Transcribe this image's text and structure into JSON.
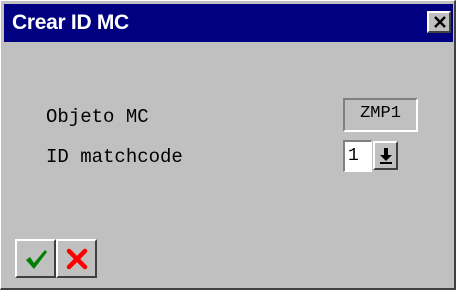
{
  "window": {
    "title": "Crear ID MC",
    "close_icon": "close-icon"
  },
  "form": {
    "objeto_label": "Objeto MC",
    "objeto_value": "ZMP1",
    "matchcode_label": "ID matchcode",
    "matchcode_value": "1",
    "dropdown_icon": "arrow-down-icon"
  },
  "toolbar": {
    "confirm_icon": "checkmark-icon",
    "cancel_icon": "cross-icon"
  },
  "colors": {
    "titlebar": "#000080",
    "window_face": "#c0c0c0",
    "confirm": "#008000",
    "cancel": "#ff0000"
  }
}
